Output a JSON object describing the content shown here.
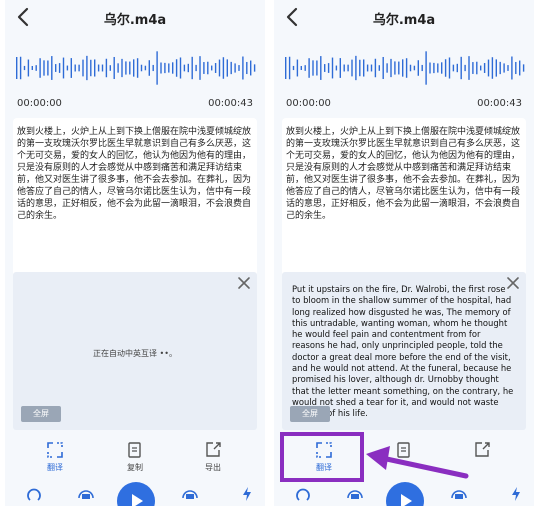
{
  "colors": {
    "accent": "#2f6fe0",
    "highlight": "#8a2ec0",
    "wave_blue": "#2e6bd6",
    "panel_bg": "#f5f8fc"
  },
  "screens": [
    {
      "title": "乌尔.m4a",
      "current_time": "00:00:00",
      "duration": "00:00:43",
      "transcript": "放到火楼上，火炉上从上到下换上僧服在院中浅夏倾城绽放的第一支玫瑰沃尔罗比医生早就意识到自己有多么厌恶，这个无可交易，爱的女人的回忆，他认为他因为他有的理由，只是没有原则的人才会感觉从中感到痛苦和满足拜访结束前，他又对医生讲了很多事，他不会去参加。在葬礼，因为他答应了自己的情人，尽管乌尔诺比医生认为，信中有一段话的意思，正好相反，他不会为此留一滴眼泪，不会浪费自己的余生。",
      "translation_status": "正在自动中英互译 ••。",
      "translation_text": "",
      "fullscreen_label": "全屏",
      "actions": [
        {
          "label": "翻译",
          "icon": "translate-icon"
        },
        {
          "label": "复制",
          "icon": "copy-icon"
        },
        {
          "label": "导出",
          "icon": "export-icon"
        }
      ]
    },
    {
      "title": "乌尔.m4a",
      "current_time": "00:00:00",
      "duration": "00:00:43",
      "transcript": "放到火楼上，火炉上从上到下换上僧服在院中浅夏倾城绽放的第一支玫瑰沃尔罗比医生早就意识到自己有多么厌恶，这个无可交易，爱的女人的回忆，他认为他因为他有的理由，只是没有原则的人才会感觉从中感到痛苦和满足拜访结束前，他又对医生讲了很多事，他不会去参加。在葬礼，因为他答应了自己的情人，尽管乌尔诺比医生认为，信中有一段话的意思，正好相反，他不会为此留一滴眼泪，不会浪费自己的余生。",
      "translation_status": "",
      "translation_text": "Put it upstairs on the fire, Dr. Walrobi, the first rose to bloom in the shallow summer of the hospital, had long realized how disgusted he was, The memory of this untradable, wanting woman, whom he thought he would feel pain and contentment from for reasons he had, only unprincipled people, told the doctor a great deal more before the end of the visit, and he would not attend. At the funeral, because he promised his lover, although dr. Urnobby thought that the letter meant something, on the contrary, he would not shed a tear for it, and would not waste the rest of his life.",
      "fullscreen_label": "全屏",
      "actions": [
        {
          "label": "翻译",
          "icon": "translate-icon"
        },
        {
          "label": "",
          "icon": "copy-icon"
        },
        {
          "label": "",
          "icon": "export-icon"
        }
      ]
    }
  ]
}
